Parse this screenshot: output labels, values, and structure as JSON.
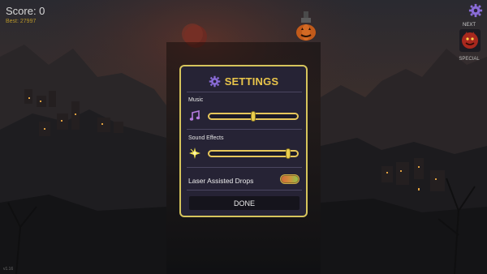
{
  "hud": {
    "score_label": "Score: 0",
    "best_label": "Best: 27997",
    "version": "v1.16"
  },
  "queue": {
    "next_label": "NEXT",
    "special_label": "SPECIAL"
  },
  "settings": {
    "title": "SETTINGS",
    "music": {
      "label": "Music",
      "icon": "music-note-icon",
      "level": 0.5
    },
    "sound_effects": {
      "label": "Sound Effects",
      "icon": "spark-icon",
      "level": 0.92
    },
    "laser": {
      "label": "Laser Assisted Drops",
      "enabled": true
    },
    "done_label": "DONE"
  },
  "colors": {
    "accent": "#e9c54a",
    "panel": "#262335",
    "border": "#d6c45c"
  }
}
